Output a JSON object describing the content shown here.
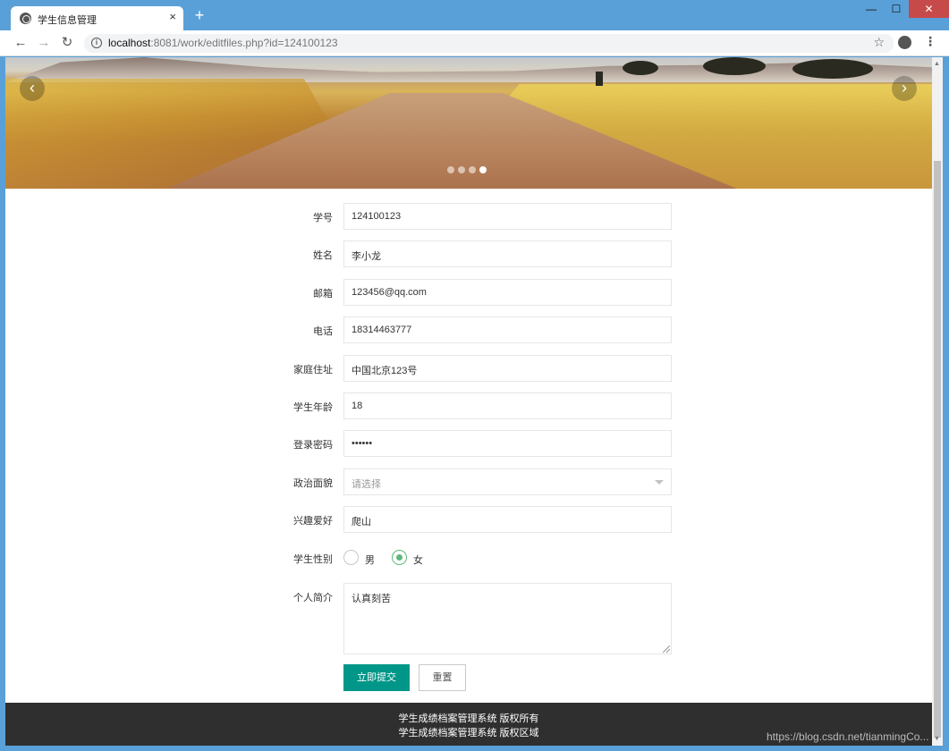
{
  "browser": {
    "tab_title": "学生信息管理",
    "tab_close": "×",
    "new_tab": "+",
    "url_host": "localhost",
    "url_rest": ":8081/work/editfiles.php?id=124100123",
    "win_minimize": "—",
    "win_maximize": "☐",
    "win_close": "✕"
  },
  "carousel": {
    "prev": "‹",
    "next": "›",
    "slide_count": 4,
    "active_slide": 4
  },
  "form": {
    "fields": [
      {
        "label": "学号",
        "value": "124100123"
      },
      {
        "label": "姓名",
        "value": "李小龙"
      },
      {
        "label": "邮箱",
        "value": "123456@qq.com"
      },
      {
        "label": "电话",
        "value": "18314463777"
      },
      {
        "label": "家庭住址",
        "value": "中国北京123号"
      },
      {
        "label": "学生年龄",
        "value": "18"
      },
      {
        "label": "登录密码",
        "value": "••••••"
      },
      {
        "label": "政治面貌",
        "placeholder": "请选择"
      },
      {
        "label": "兴趣爱好",
        "value": "爬山"
      }
    ],
    "gender": {
      "label": "学生性别",
      "options": [
        "男",
        "女"
      ],
      "selected": "女"
    },
    "intro": {
      "label": "个人简介",
      "value": "认真刻苦"
    },
    "submit_label": "立即提交",
    "reset_label": "重置"
  },
  "footer": {
    "line1": "学生成绩档案管理系统 版权所有",
    "line2": "学生成绩档案管理系统 版权区域"
  },
  "watermark": "https://blog.csdn.net/tianmingCo..."
}
